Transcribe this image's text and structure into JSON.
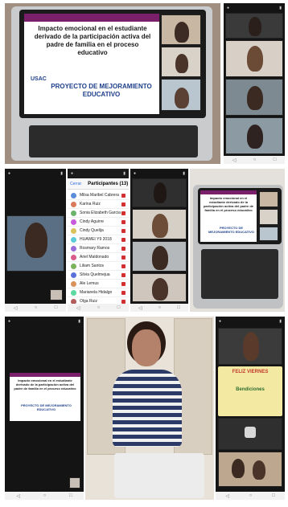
{
  "laptop_slide": {
    "title": "Impacto emocional en el estudiante derivado de la participación activa del padre de familia en el proceso educativo",
    "logo": "USAC",
    "subtitle": "PROYECTO DE MEJORAMIENTO EDUCATIVO"
  },
  "participants_panel": {
    "close_label": "Cerrar",
    "title": "Participantes (13)",
    "items": [
      "Milsa Maribel Cabrera",
      "Karina Ruiz",
      "Sonia Elizabeth Garcia Mazo",
      "Cindy Aguirre",
      "Cindy Quelija",
      "HUAWEI Y9 2018",
      "Rosmary Ramos",
      "Ariel Maldonado",
      "Liliam Santos",
      "Silvia Quelmejua",
      "Ale Lemus",
      "Marianela Hidalgo",
      "Olga Ruiz"
    ]
  },
  "phone_slide": {
    "title": "Impacto emocional en el estudiante derivado de la participación activa del padre de familia en el proceso educativo",
    "subtitle": "PROYECTO DE MEJORAMIENTO EDUCATIVO"
  },
  "posters": {
    "card1": "FELIZ VIERNES",
    "card2": "Bendiciones"
  },
  "colors": {
    "slide_accent": "#7a1f6a",
    "slide_blue": "#1d3f8a",
    "mic_muted": "#d23030"
  }
}
